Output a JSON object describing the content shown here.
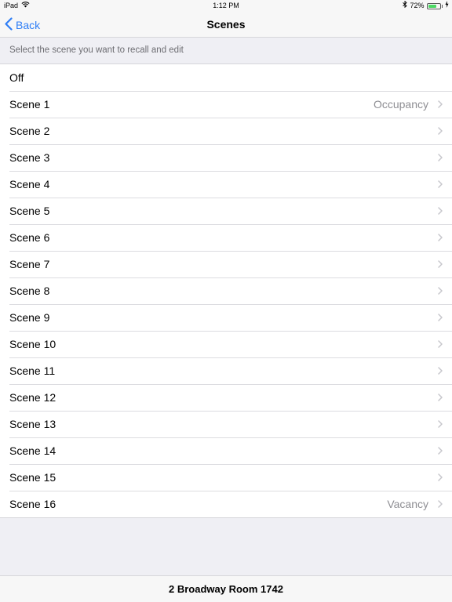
{
  "status_bar": {
    "device": "iPad",
    "time": "1:12 PM",
    "battery_percent": "72%",
    "battery_level": 0.72,
    "icons": [
      "wifi-icon",
      "bluetooth-icon",
      "battery-icon",
      "charging-icon"
    ]
  },
  "nav": {
    "back_label": "Back",
    "title": "Scenes"
  },
  "section": {
    "header": "Select the scene you want to recall and edit"
  },
  "scenes": [
    {
      "label": "Off",
      "detail": "",
      "chevron": false
    },
    {
      "label": "Scene 1",
      "detail": "Occupancy",
      "chevron": true
    },
    {
      "label": "Scene 2",
      "detail": "",
      "chevron": true
    },
    {
      "label": "Scene 3",
      "detail": "",
      "chevron": true
    },
    {
      "label": "Scene 4",
      "detail": "",
      "chevron": true
    },
    {
      "label": "Scene 5",
      "detail": "",
      "chevron": true
    },
    {
      "label": "Scene 6",
      "detail": "",
      "chevron": true
    },
    {
      "label": "Scene 7",
      "detail": "",
      "chevron": true
    },
    {
      "label": "Scene 8",
      "detail": "",
      "chevron": true
    },
    {
      "label": "Scene 9",
      "detail": "",
      "chevron": true
    },
    {
      "label": "Scene 10",
      "detail": "",
      "chevron": true
    },
    {
      "label": "Scene 11",
      "detail": "",
      "chevron": true
    },
    {
      "label": "Scene 12",
      "detail": "",
      "chevron": true
    },
    {
      "label": "Scene 13",
      "detail": "",
      "chevron": true
    },
    {
      "label": "Scene 14",
      "detail": "",
      "chevron": true
    },
    {
      "label": "Scene 15",
      "detail": "",
      "chevron": true
    },
    {
      "label": "Scene 16",
      "detail": "Vacancy",
      "chevron": true
    }
  ],
  "footer": {
    "room": "2 Broadway Room 1742"
  },
  "colors": {
    "accent": "#2f7ef6",
    "background": "#efeff4",
    "detail_text": "#8e8e93",
    "battery_green": "#4cd964"
  }
}
